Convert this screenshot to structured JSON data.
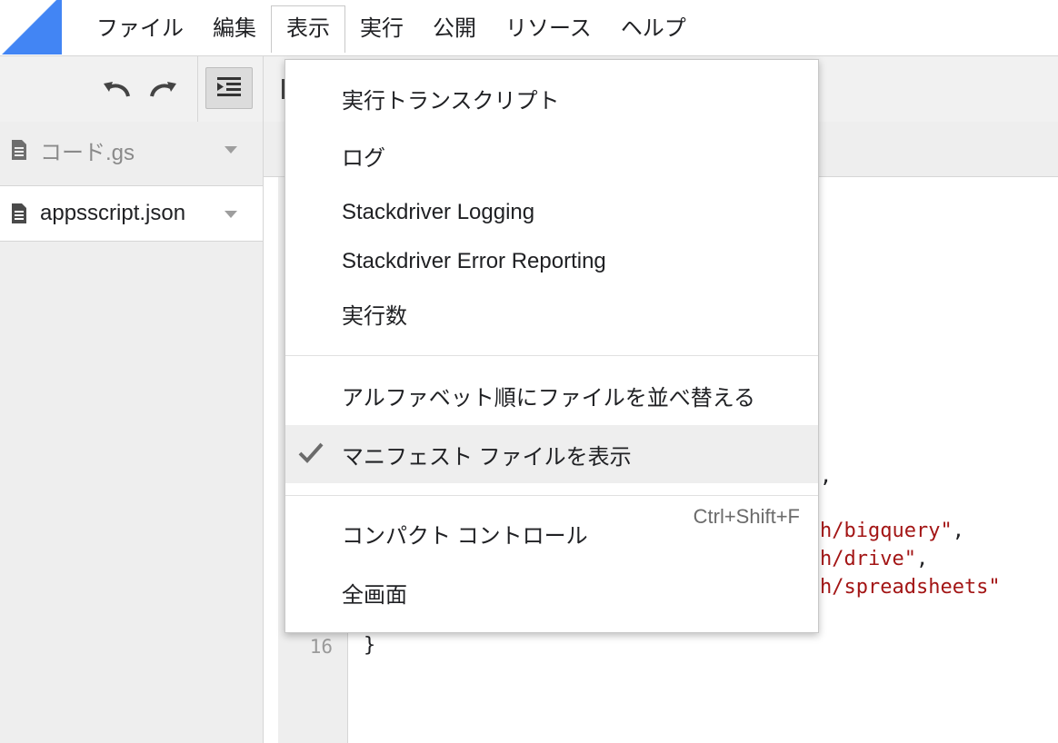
{
  "menubar": {
    "items": [
      {
        "label": "ファイル"
      },
      {
        "label": "編集"
      },
      {
        "label": "表示",
        "active": true
      },
      {
        "label": "実行"
      },
      {
        "label": "公開"
      },
      {
        "label": "リソース"
      },
      {
        "label": "ヘルプ"
      }
    ]
  },
  "files": [
    {
      "name": "コード.gs",
      "selected": false
    },
    {
      "name": "appsscript.json",
      "selected": true
    }
  ],
  "view_menu": {
    "items": [
      {
        "label": "実行トランスクリプト"
      },
      {
        "label": "ログ"
      },
      {
        "label": "Stackdriver Logging"
      },
      {
        "label": "Stackdriver Error Reporting"
      },
      {
        "label": "実行数"
      },
      {
        "label": "アルファベット順にファイルを並べ替える"
      },
      {
        "label": "マニフェスト ファイルを表示",
        "checked": true
      },
      {
        "label": "コンパクト コントロール",
        "shortcut": "Ctrl+Shift+F"
      },
      {
        "label": "全画面"
      }
    ]
  },
  "editor": {
    "line_number": "16",
    "lines": [
      {
        "text": ","
      },
      {
        "text": "h/bigquery\"",
        "suffix": ","
      },
      {
        "text": "h/drive\"",
        "suffix": ","
      },
      {
        "text": "h/spreadsheets\"",
        "suffix": ""
      },
      {
        "text": "}"
      }
    ]
  },
  "colors": {
    "accent": "#4285f4",
    "string": "#a31515",
    "menu_hover": "#eeeeee"
  }
}
